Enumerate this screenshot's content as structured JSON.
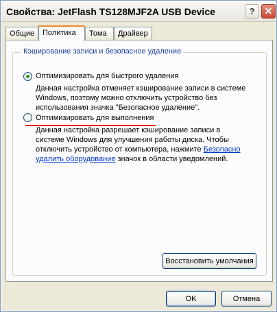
{
  "window": {
    "title": "Свойства: JetFlash TS128MJF2A USB Device",
    "help_symbol": "?",
    "close_symbol": "✕"
  },
  "tabs": [
    {
      "label": "Общие",
      "active": false
    },
    {
      "label": "Политика",
      "active": true
    },
    {
      "label": "Тома",
      "active": false
    },
    {
      "label": "Драйвер",
      "active": false
    }
  ],
  "group": {
    "legend": "Кэширование записи и безопасное удаление"
  },
  "options": {
    "quick_removal": {
      "label": "Оптимизировать для быстрого удаления",
      "selected": true,
      "desc_line1": "Данная настройка отменяет кэширование записи в системе",
      "desc_line2": "Windows, поэтому можно отключить устройство без",
      "desc_line3": "использования значка \"Безопасное удаление\"."
    },
    "performance": {
      "label": "Оптимизировать для выполнения",
      "selected": false,
      "desc_line1": "Данная настройка разрешает кэширование записи в",
      "desc_line2": "системе Windows для улучшения работы диска. Чтобы",
      "desc_line3_a": "отключить устройство от компьютера, нажмите ",
      "desc_line3_link": "Безопасно",
      "desc_line4_link": "удалить оборудование",
      "desc_line4_b": " значок в области уведомлений."
    }
  },
  "buttons": {
    "restore_defaults": "Восстановить умолчания",
    "ok": "OK",
    "cancel": "Отмена"
  },
  "colors": {
    "selected_radio": "#21a121",
    "annotation_underline": "#e00000",
    "link": "#0033cc",
    "group_legend": "#1c3f9e"
  }
}
